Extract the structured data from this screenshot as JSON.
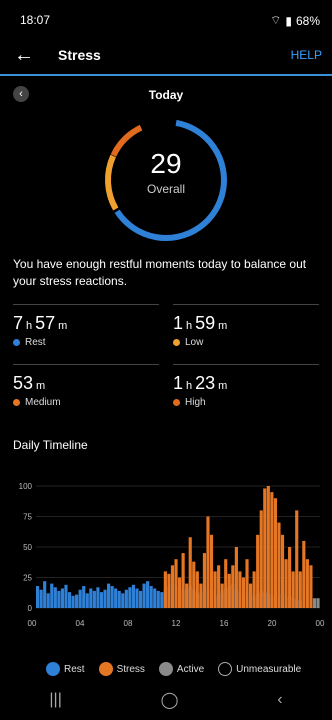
{
  "status": {
    "time": "18:07",
    "battery": "68%"
  },
  "header": {
    "title": "Stress",
    "help": "HELP"
  },
  "date": {
    "label": "Today"
  },
  "score": {
    "value": "29",
    "label": "Overall"
  },
  "message": "You have enough restful moments today to balance out your stress reactions.",
  "stats": [
    {
      "h": "7",
      "hu": "h",
      "m": "57",
      "mu": "m",
      "label": "Rest",
      "color": "#2f80d7"
    },
    {
      "h": "1",
      "hu": "h",
      "m": "59",
      "mu": "m",
      "label": "Low",
      "color": "#f0a030"
    },
    {
      "h": "",
      "hu": "",
      "m": "53",
      "mu": "m",
      "label": "Medium",
      "color": "#e57624"
    },
    {
      "h": "1",
      "hu": "h",
      "m": "23",
      "mu": "m",
      "label": "High",
      "color": "#e06a1e"
    }
  ],
  "timeline": {
    "title": "Daily Timeline"
  },
  "chart_data": {
    "type": "bar",
    "yticks": [
      "0",
      "25",
      "50",
      "75",
      "100"
    ],
    "ylim": [
      0,
      100
    ],
    "xticks": [
      "00",
      "04",
      "08",
      "12",
      "16",
      "20",
      "00"
    ],
    "series": [
      {
        "name": "Rest",
        "values": [
          18,
          15,
          22,
          12,
          20,
          17,
          14,
          16,
          19,
          13,
          10,
          11,
          15,
          18,
          12,
          16,
          14,
          17,
          13,
          15,
          20,
          18,
          16,
          14,
          12,
          15,
          17,
          19,
          16,
          14,
          20,
          22,
          18,
          16,
          14,
          13,
          16,
          18,
          20,
          17,
          15,
          14,
          16,
          18,
          15,
          13,
          12,
          14,
          16,
          15,
          10,
          12,
          14,
          16,
          18,
          20,
          15,
          13,
          12,
          14,
          11,
          10,
          12,
          14,
          13,
          12,
          11,
          10,
          12,
          11,
          9,
          10,
          8,
          7,
          6,
          0,
          0,
          0,
          0,
          0
        ]
      },
      {
        "name": "Stress",
        "values": [
          0,
          0,
          0,
          0,
          0,
          0,
          0,
          0,
          0,
          0,
          0,
          0,
          0,
          0,
          0,
          0,
          0,
          0,
          0,
          0,
          0,
          0,
          0,
          0,
          0,
          0,
          0,
          0,
          0,
          0,
          0,
          0,
          0,
          0,
          0,
          0,
          30,
          28,
          35,
          40,
          25,
          45,
          20,
          58,
          38,
          30,
          20,
          45,
          75,
          60,
          30,
          35,
          20,
          40,
          28,
          35,
          50,
          30,
          25,
          40,
          20,
          30,
          60,
          80,
          98,
          100,
          95,
          90,
          70,
          60,
          40,
          50,
          30,
          80,
          30,
          55,
          40,
          35,
          0,
          0
        ]
      },
      {
        "name": "Active",
        "values": [
          0,
          0,
          0,
          0,
          0,
          0,
          0,
          0,
          0,
          0,
          0,
          0,
          0,
          0,
          0,
          0,
          0,
          0,
          0,
          0,
          0,
          0,
          0,
          0,
          0,
          0,
          0,
          0,
          0,
          0,
          0,
          0,
          0,
          0,
          0,
          0,
          0,
          0,
          0,
          0,
          0,
          0,
          0,
          0,
          0,
          0,
          0,
          0,
          0,
          0,
          0,
          0,
          0,
          0,
          0,
          0,
          0,
          0,
          0,
          0,
          0,
          0,
          0,
          0,
          0,
          0,
          0,
          0,
          0,
          0,
          0,
          0,
          0,
          0,
          0,
          0,
          0,
          0,
          8,
          8
        ]
      }
    ],
    "legend": [
      "Rest",
      "Stress",
      "Active",
      "Unmeasurable"
    ]
  },
  "legend_colors": {
    "rest": "#2f80d7",
    "stress": "#e57624",
    "active": "#8a8a8a",
    "unmeasurable": "transparent"
  }
}
